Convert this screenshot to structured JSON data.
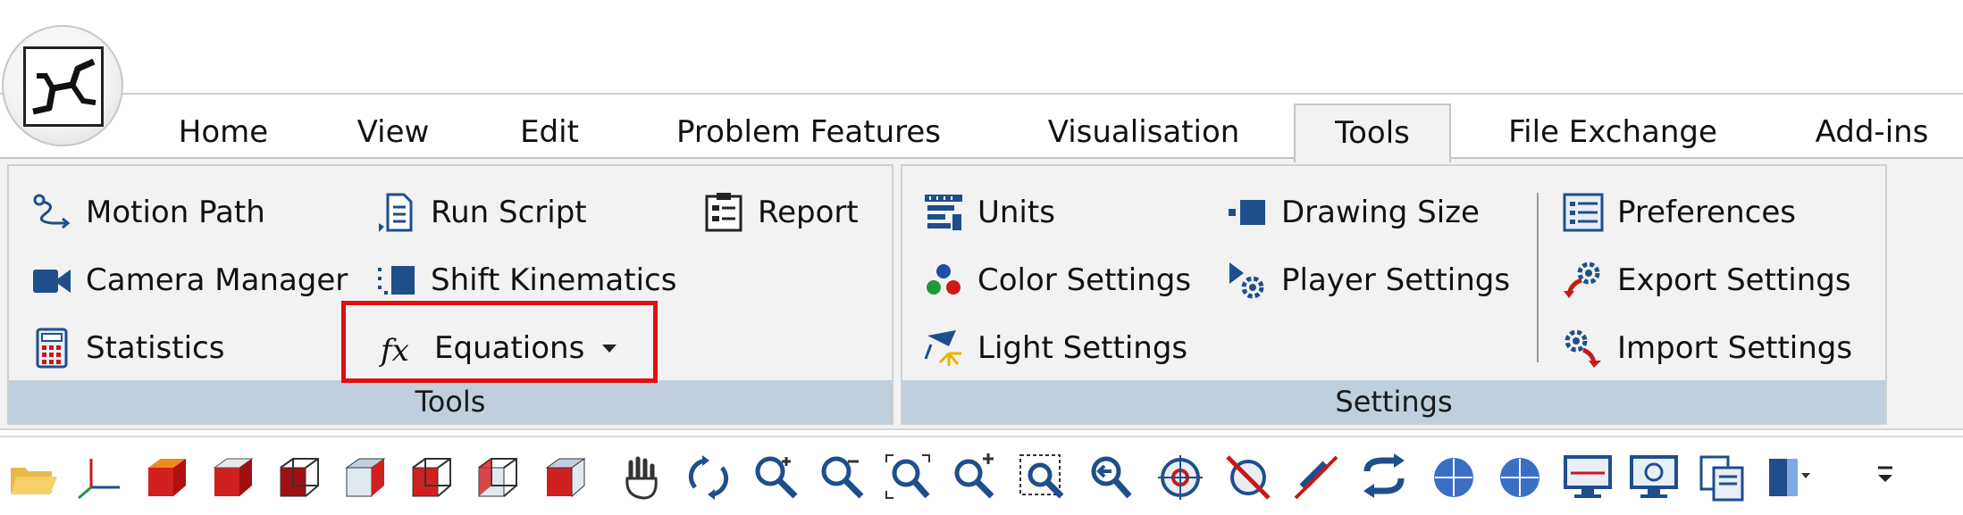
{
  "tabs": [
    {
      "label": "Home"
    },
    {
      "label": "View"
    },
    {
      "label": "Edit"
    },
    {
      "label": "Problem Features"
    },
    {
      "label": "Visualisation"
    },
    {
      "label": "Tools",
      "active": true
    },
    {
      "label": "File Exchange"
    },
    {
      "label": "Add-ins"
    }
  ],
  "tools_group": {
    "label": "Tools",
    "commands": [
      {
        "label": "Motion Path",
        "icon": "motion-path-icon"
      },
      {
        "label": "Run Script",
        "icon": "run-script-icon"
      },
      {
        "label": "Report",
        "icon": "report-icon"
      },
      {
        "label": "Camera Manager",
        "icon": "camera-icon"
      },
      {
        "label": "Shift Kinematics",
        "icon": "shift-kinematics-icon"
      },
      {
        "label": "Statistics",
        "icon": "calculator-icon"
      },
      {
        "label": "Equations",
        "icon": "fx-icon",
        "has_dropdown": true
      }
    ]
  },
  "settings_group": {
    "label": "Settings",
    "commands": [
      {
        "label": "Units",
        "icon": "units-icon"
      },
      {
        "label": "Drawing Size",
        "icon": "drawing-size-icon"
      },
      {
        "label": "Preferences",
        "icon": "preferences-icon"
      },
      {
        "label": "Color Settings",
        "icon": "color-dots-icon"
      },
      {
        "label": "Player Settings",
        "icon": "player-settings-icon"
      },
      {
        "label": "Export Settings",
        "icon": "export-settings-icon"
      },
      {
        "label": "Light Settings",
        "icon": "light-settings-icon"
      },
      {
        "label": "Import Settings",
        "icon": "import-settings-icon"
      }
    ]
  },
  "toolbar_icons": [
    "open-folder-icon",
    "axes-icon",
    "cube-solid-icon",
    "cube-front-icon",
    "cube-top-icon",
    "cube-side-icon",
    "cube-back-icon",
    "cube-left-icon",
    "cube-wire-icon",
    "cube-bottom-icon",
    "hand-pan-icon",
    "rotate-icon",
    "zoom-in-icon",
    "zoom-out-icon",
    "zoom-fit-icon",
    "zoom-plus-icon",
    "zoom-window-icon",
    "zoom-back-icon",
    "target-icon",
    "no-target-icon",
    "no-link-icon",
    "loop-icon",
    "sphere-up-icon",
    "sphere-down-icon",
    "monitor-icon",
    "monitor-settings-icon",
    "copy-picture-icon",
    "cylinder-icon",
    "overflow-icon"
  ],
  "colors": {
    "ribbon_bg": "#f2f2f2",
    "group_label_bg": "#bfcfdd",
    "highlight": "#e01010",
    "icon_blue": "#1f4e8c",
    "icon_red": "#c81818"
  }
}
